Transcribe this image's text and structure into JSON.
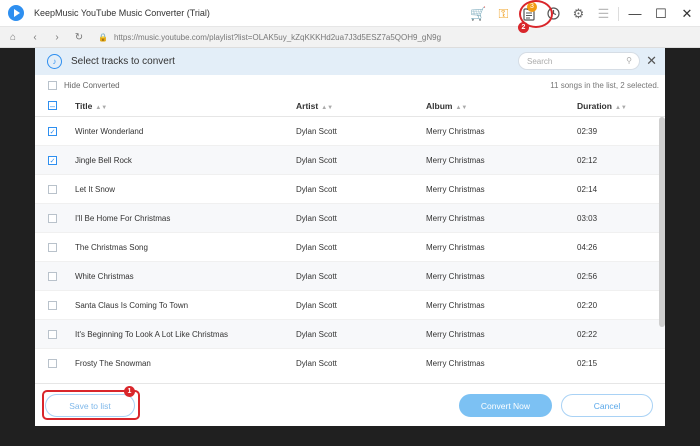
{
  "app": {
    "title": "KeepMusic YouTube Music Converter (Trial)"
  },
  "toolbar": {
    "list_badge": "3"
  },
  "address": {
    "url": "https://music.youtube.com/playlist?list=OLAK5uy_kZqKKKHd2ua7J3d5ESZ7a5QOH9_gN9g"
  },
  "modal": {
    "title": "Select tracks to convert",
    "search_placeholder": "Search",
    "hide_converted_label": "Hide Converted",
    "count_text": "11 songs in the list, 2 selected.",
    "columns": {
      "title": "Title",
      "artist": "Artist",
      "album": "Album",
      "duration": "Duration"
    },
    "rows": [
      {
        "checked": true,
        "title": "Winter Wonderland",
        "artist": "Dylan Scott",
        "album": "Merry Christmas",
        "duration": "02:39"
      },
      {
        "checked": true,
        "title": "Jingle Bell Rock",
        "artist": "Dylan Scott",
        "album": "Merry Christmas",
        "duration": "02:12"
      },
      {
        "checked": false,
        "title": "Let It Snow",
        "artist": "Dylan Scott",
        "album": "Merry Christmas",
        "duration": "02:14"
      },
      {
        "checked": false,
        "title": "I'll Be Home For Christmas",
        "artist": "Dylan Scott",
        "album": "Merry Christmas",
        "duration": "03:03"
      },
      {
        "checked": false,
        "title": "The Christmas Song",
        "artist": "Dylan Scott",
        "album": "Merry Christmas",
        "duration": "04:26"
      },
      {
        "checked": false,
        "title": "White Christmas",
        "artist": "Dylan Scott",
        "album": "Merry Christmas",
        "duration": "02:56"
      },
      {
        "checked": false,
        "title": "Santa Claus Is Coming To Town",
        "artist": "Dylan Scott",
        "album": "Merry Christmas",
        "duration": "02:20"
      },
      {
        "checked": false,
        "title": "It's Beginning To Look A Lot Like Christmas",
        "artist": "Dylan Scott",
        "album": "Merry Christmas",
        "duration": "02:22"
      },
      {
        "checked": false,
        "title": "Frosty The Snowman",
        "artist": "Dylan Scott",
        "album": "Merry Christmas",
        "duration": "02:15"
      }
    ],
    "buttons": {
      "save": "Save to list",
      "convert": "Convert Now",
      "cancel": "Cancel"
    }
  },
  "callouts": {
    "one": "1",
    "two": "2"
  },
  "colors": {
    "accent": "#2e8ff0",
    "callout": "#d9262b",
    "badge": "#f39c12"
  }
}
